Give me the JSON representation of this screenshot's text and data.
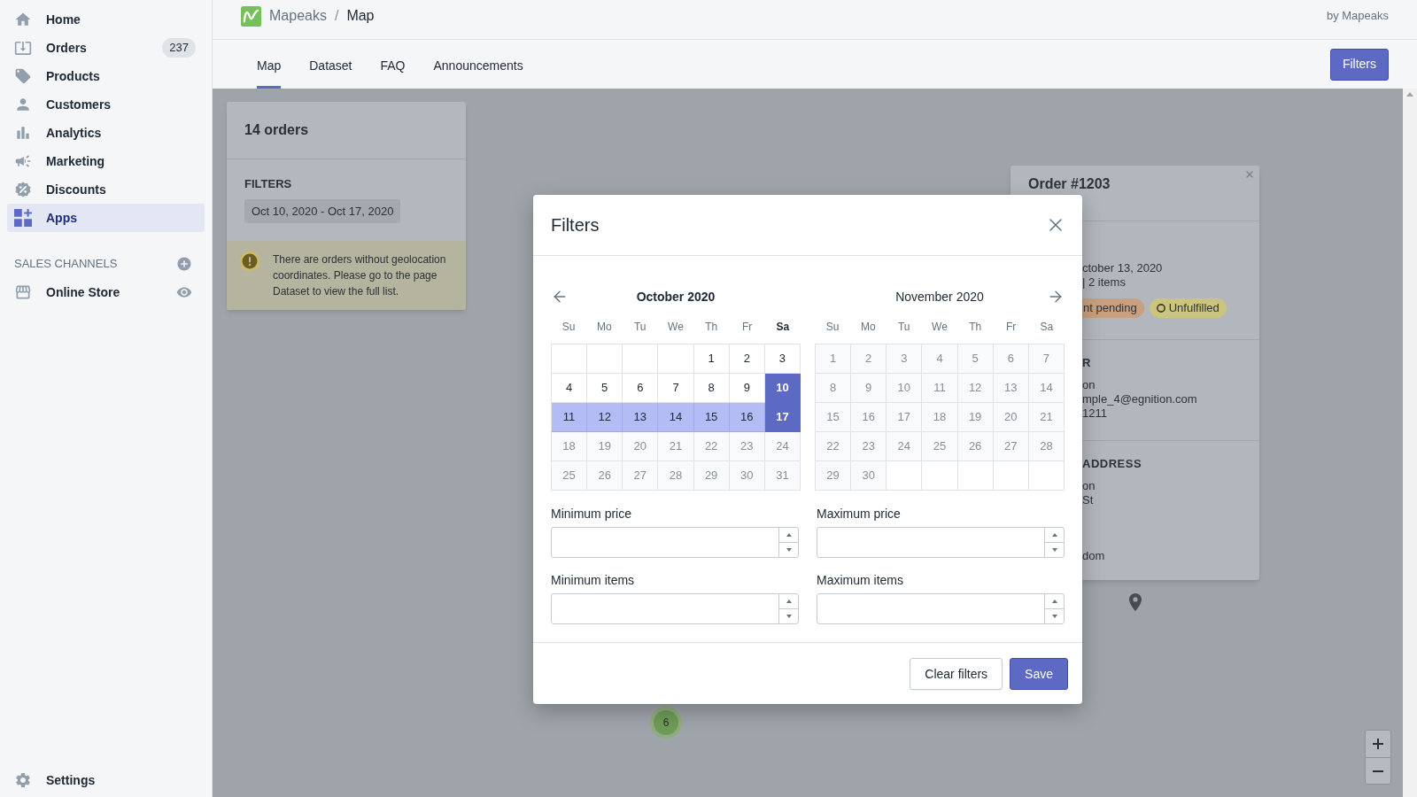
{
  "sidebar": {
    "items": [
      {
        "label": "Home",
        "selected": false
      },
      {
        "label": "Orders",
        "badge": "237",
        "selected": false
      },
      {
        "label": "Products",
        "selected": false
      },
      {
        "label": "Customers",
        "selected": false
      },
      {
        "label": "Analytics",
        "selected": false
      },
      {
        "label": "Marketing",
        "selected": false
      },
      {
        "label": "Discounts",
        "selected": false
      },
      {
        "label": "Apps",
        "selected": true
      }
    ],
    "sales_channels": {
      "heading": "SALES CHANNELS",
      "items": [
        {
          "label": "Online Store",
          "selected": false
        }
      ]
    },
    "settings": {
      "label": "Settings",
      "selected": false
    }
  },
  "app_bar": {
    "app_name": "Mapeaks",
    "separator": "/",
    "page_title": "Map",
    "publisher": "by Mapeaks"
  },
  "tabs": [
    {
      "label": "Map",
      "selected": true
    },
    {
      "label": "Dataset",
      "selected": false
    },
    {
      "label": "FAQ",
      "selected": false
    },
    {
      "label": "Announcements",
      "selected": false
    }
  ],
  "filters_button": {
    "label": "Filters"
  },
  "map": {
    "summary": {
      "title": "14 orders",
      "filters_heading": "FILTERS",
      "filter_tags": [
        "Oct 10, 2020 - Oct 17, 2020"
      ],
      "warning": "There are orders without geolocation coordinates. Please go to the page Dataset to view the full list."
    },
    "order": {
      "title": "Order #1203",
      "details": [
        "ctober 13, 2020",
        "| 2 items"
      ],
      "badges": [
        {
          "label": "nt pending",
          "color": "#c9a07f",
          "clipped": true
        },
        {
          "label": "Unfulfilled",
          "color": "#cbc47f",
          "clipped": false
        }
      ],
      "sections": [
        {
          "heading": "R",
          "lines": [
            "on",
            "mple_4@egnition.com",
            "1211"
          ]
        },
        {
          "heading": "ADDRESS",
          "lines": [
            "on",
            "St",
            "dom"
          ]
        }
      ]
    },
    "cluster": {
      "count": "6"
    }
  },
  "filters_dialog": {
    "title": "Filters",
    "months": [
      {
        "title": "October 2020",
        "highlighted": true,
        "weekdays": [
          {
            "label": "Su",
            "highlighted": false
          },
          {
            "label": "Mo",
            "highlighted": false
          },
          {
            "label": "Tu",
            "highlighted": false
          },
          {
            "label": "We",
            "highlighted": false
          },
          {
            "label": "Th",
            "highlighted": false
          },
          {
            "label": "Fr",
            "highlighted": false
          },
          {
            "label": "Sa",
            "highlighted": true
          }
        ],
        "days": [
          {
            "kind": "blank"
          },
          {
            "kind": "blank"
          },
          {
            "kind": "blank"
          },
          {
            "kind": "blank"
          },
          {
            "kind": "day",
            "label": "1",
            "selected": false,
            "in_range": false,
            "disabled": false
          },
          {
            "kind": "day",
            "label": "2",
            "selected": false,
            "in_range": false,
            "disabled": false
          },
          {
            "kind": "day",
            "label": "3",
            "selected": false,
            "in_range": false,
            "disabled": false
          },
          {
            "kind": "day",
            "label": "4",
            "selected": false,
            "in_range": false,
            "disabled": false
          },
          {
            "kind": "day",
            "label": "5",
            "selected": false,
            "in_range": false,
            "disabled": false
          },
          {
            "kind": "day",
            "label": "6",
            "selected": false,
            "in_range": false,
            "disabled": false
          },
          {
            "kind": "day",
            "label": "7",
            "selected": false,
            "in_range": false,
            "disabled": false
          },
          {
            "kind": "day",
            "label": "8",
            "selected": false,
            "in_range": false,
            "disabled": false
          },
          {
            "kind": "day",
            "label": "9",
            "selected": false,
            "in_range": false,
            "disabled": false
          },
          {
            "kind": "day",
            "label": "10",
            "selected": true,
            "in_range": false,
            "disabled": false
          },
          {
            "kind": "day",
            "label": "11",
            "selected": false,
            "in_range": true,
            "disabled": false
          },
          {
            "kind": "day",
            "label": "12",
            "selected": false,
            "in_range": true,
            "disabled": false
          },
          {
            "kind": "day",
            "label": "13",
            "selected": false,
            "in_range": true,
            "disabled": false
          },
          {
            "kind": "day",
            "label": "14",
            "selected": false,
            "in_range": true,
            "disabled": false
          },
          {
            "kind": "day",
            "label": "15",
            "selected": false,
            "in_range": true,
            "disabled": false
          },
          {
            "kind": "day",
            "label": "16",
            "selected": false,
            "in_range": true,
            "disabled": false
          },
          {
            "kind": "day",
            "label": "17",
            "selected": true,
            "in_range": false,
            "disabled": false
          },
          {
            "kind": "day",
            "label": "18",
            "selected": false,
            "in_range": false,
            "disabled": true
          },
          {
            "kind": "day",
            "label": "19",
            "selected": false,
            "in_range": false,
            "disabled": true
          },
          {
            "kind": "day",
            "label": "20",
            "selected": false,
            "in_range": false,
            "disabled": true
          },
          {
            "kind": "day",
            "label": "21",
            "selected": false,
            "in_range": false,
            "disabled": true
          },
          {
            "kind": "day",
            "label": "22",
            "selected": false,
            "in_range": false,
            "disabled": true
          },
          {
            "kind": "day",
            "label": "23",
            "selected": false,
            "in_range": false,
            "disabled": true
          },
          {
            "kind": "day",
            "label": "24",
            "selected": false,
            "in_range": false,
            "disabled": true
          },
          {
            "kind": "day",
            "label": "25",
            "selected": false,
            "in_range": false,
            "disabled": true
          },
          {
            "kind": "day",
            "label": "26",
            "selected": false,
            "in_range": false,
            "disabled": true
          },
          {
            "kind": "day",
            "label": "27",
            "selected": false,
            "in_range": false,
            "disabled": true
          },
          {
            "kind": "day",
            "label": "28",
            "selected": false,
            "in_range": false,
            "disabled": true
          },
          {
            "kind": "day",
            "label": "29",
            "selected": false,
            "in_range": false,
            "disabled": true
          },
          {
            "kind": "day",
            "label": "30",
            "selected": false,
            "in_range": false,
            "disabled": true
          },
          {
            "kind": "day",
            "label": "31",
            "selected": false,
            "in_range": false,
            "disabled": true
          }
        ]
      },
      {
        "title": "November 2020",
        "highlighted": false,
        "weekdays": [
          {
            "label": "Su",
            "highlighted": false
          },
          {
            "label": "Mo",
            "highlighted": false
          },
          {
            "label": "Tu",
            "highlighted": false
          },
          {
            "label": "We",
            "highlighted": false
          },
          {
            "label": "Th",
            "highlighted": false
          },
          {
            "label": "Fr",
            "highlighted": false
          },
          {
            "label": "Sa",
            "highlighted": false
          }
        ],
        "days": [
          {
            "kind": "day",
            "label": "1",
            "selected": false,
            "in_range": false,
            "disabled": true
          },
          {
            "kind": "day",
            "label": "2",
            "selected": false,
            "in_range": false,
            "disabled": true
          },
          {
            "kind": "day",
            "label": "3",
            "selected": false,
            "in_range": false,
            "disabled": true
          },
          {
            "kind": "day",
            "label": "4",
            "selected": false,
            "in_range": false,
            "disabled": true
          },
          {
            "kind": "day",
            "label": "5",
            "selected": false,
            "in_range": false,
            "disabled": true
          },
          {
            "kind": "day",
            "label": "6",
            "selected": false,
            "in_range": false,
            "disabled": true
          },
          {
            "kind": "day",
            "label": "7",
            "selected": false,
            "in_range": false,
            "disabled": true
          },
          {
            "kind": "day",
            "label": "8",
            "selected": false,
            "in_range": false,
            "disabled": true
          },
          {
            "kind": "day",
            "label": "9",
            "selected": false,
            "in_range": false,
            "disabled": true
          },
          {
            "kind": "day",
            "label": "10",
            "selected": false,
            "in_range": false,
            "disabled": true
          },
          {
            "kind": "day",
            "label": "11",
            "selected": false,
            "in_range": false,
            "disabled": true
          },
          {
            "kind": "day",
            "label": "12",
            "selected": false,
            "in_range": false,
            "disabled": true
          },
          {
            "kind": "day",
            "label": "13",
            "selected": false,
            "in_range": false,
            "disabled": true
          },
          {
            "kind": "day",
            "label": "14",
            "selected": false,
            "in_range": false,
            "disabled": true
          },
          {
            "kind": "day",
            "label": "15",
            "selected": false,
            "in_range": false,
            "disabled": true
          },
          {
            "kind": "day",
            "label": "16",
            "selected": false,
            "in_range": false,
            "disabled": true
          },
          {
            "kind": "day",
            "label": "17",
            "selected": false,
            "in_range": false,
            "disabled": true
          },
          {
            "kind": "day",
            "label": "18",
            "selected": false,
            "in_range": false,
            "disabled": true
          },
          {
            "kind": "day",
            "label": "19",
            "selected": false,
            "in_range": false,
            "disabled": true
          },
          {
            "kind": "day",
            "label": "20",
            "selected": false,
            "in_range": false,
            "disabled": true
          },
          {
            "kind": "day",
            "label": "21",
            "selected": false,
            "in_range": false,
            "disabled": true
          },
          {
            "kind": "day",
            "label": "22",
            "selected": false,
            "in_range": false,
            "disabled": true
          },
          {
            "kind": "day",
            "label": "23",
            "selected": false,
            "in_range": false,
            "disabled": true
          },
          {
            "kind": "day",
            "label": "24",
            "selected": false,
            "in_range": false,
            "disabled": true
          },
          {
            "kind": "day",
            "label": "25",
            "selected": false,
            "in_range": false,
            "disabled": true
          },
          {
            "kind": "day",
            "label": "26",
            "selected": false,
            "in_range": false,
            "disabled": true
          },
          {
            "kind": "day",
            "label": "27",
            "selected": false,
            "in_range": false,
            "disabled": true
          },
          {
            "kind": "day",
            "label": "28",
            "selected": false,
            "in_range": false,
            "disabled": true
          },
          {
            "kind": "day",
            "label": "29",
            "selected": false,
            "in_range": false,
            "disabled": true
          },
          {
            "kind": "day",
            "label": "30",
            "selected": false,
            "in_range": false,
            "disabled": true
          },
          {
            "kind": "blank"
          },
          {
            "kind": "blank"
          },
          {
            "kind": "blank"
          },
          {
            "kind": "blank"
          },
          {
            "kind": "blank"
          }
        ]
      }
    ],
    "fields": [
      {
        "label": "Minimum price"
      },
      {
        "label": "Maximum price"
      },
      {
        "label": "Minimum items"
      },
      {
        "label": "Maximum items"
      }
    ],
    "buttons": [
      {
        "label": "Clear filters",
        "kind": "secondary"
      },
      {
        "label": "Save",
        "kind": "primary"
      }
    ]
  }
}
